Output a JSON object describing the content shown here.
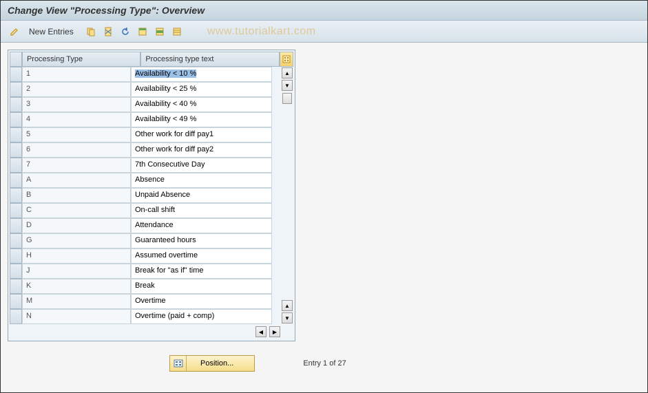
{
  "title": "Change View \"Processing Type\": Overview",
  "toolbar": {
    "new_entries_label": "New Entries"
  },
  "watermark": "www.tutorialkart.com",
  "table": {
    "headers": {
      "type": "Processing Type",
      "text": "Processing type text"
    },
    "rows": [
      {
        "type": "1",
        "text": "Availability < 10 %",
        "selected": true
      },
      {
        "type": "2",
        "text": "Availability < 25 %"
      },
      {
        "type": "3",
        "text": "Availability < 40 %"
      },
      {
        "type": "4",
        "text": "Availability < 49 %"
      },
      {
        "type": "5",
        "text": "Other work for diff pay1"
      },
      {
        "type": "6",
        "text": "Other work for diff pay2"
      },
      {
        "type": "7",
        "text": "7th Consecutive Day"
      },
      {
        "type": "A",
        "text": "Absence"
      },
      {
        "type": "B",
        "text": "Unpaid Absence"
      },
      {
        "type": "C",
        "text": "On-call shift"
      },
      {
        "type": "D",
        "text": "Attendance"
      },
      {
        "type": "G",
        "text": "Guaranteed hours"
      },
      {
        "type": "H",
        "text": "Assumed overtime"
      },
      {
        "type": "J",
        "text": "Break for \"as if\" time"
      },
      {
        "type": "K",
        "text": "Break"
      },
      {
        "type": "M",
        "text": "Overtime"
      },
      {
        "type": "N",
        "text": "Overtime (paid + comp)"
      }
    ]
  },
  "footer": {
    "position_label": "Position...",
    "entry_info": "Entry 1 of 27"
  }
}
